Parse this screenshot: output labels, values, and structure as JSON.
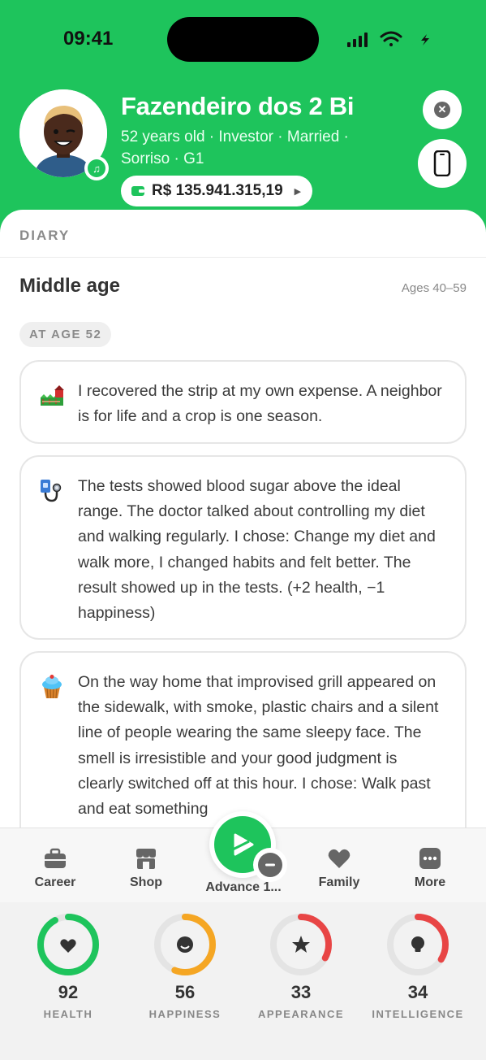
{
  "status_bar": {
    "time": "09:41"
  },
  "profile": {
    "name": "Fazendeiro dos 2 Bi",
    "subtitle": "52 years old · Investor · Married · Sorriso · G1",
    "money": "R$ 135.941.315,19"
  },
  "diary": {
    "label": "DIARY",
    "section_title": "Middle age",
    "section_range": "Ages 40–59",
    "age_chip": "AT AGE 52",
    "entries": [
      {
        "icon": "farm-icon",
        "text": "I recovered the strip at my own expense. A neighbor is for life and a crop is one season."
      },
      {
        "icon": "stethoscope-icon",
        "text": "The tests showed blood sugar above the ideal range. The doctor talked about controlling my diet and walking regularly. I chose: Change my diet and walk more, I changed habits and felt better. The result showed up in the tests. (+2 health, −1 happiness)"
      },
      {
        "icon": "cupcake-icon",
        "text": "On the way home that improvised grill appeared on the sidewalk, with smoke, plastic chairs and a silent line of people wearing the same sleepy face. The smell is irresistible and your good judgment is clearly switched off at this hour. I chose: Walk past and eat something"
      }
    ]
  },
  "nav": {
    "career": "Career",
    "shop": "Shop",
    "advance": "Advance 1...",
    "family": "Family",
    "more": "More"
  },
  "stats": [
    {
      "name": "HEALTH",
      "value": "92",
      "level": 0.92,
      "color": "#1ec45c",
      "icon": "heart-icon"
    },
    {
      "name": "HAPPINESS",
      "value": "56",
      "level": 0.56,
      "color": "#f5a623",
      "icon": "smile-icon"
    },
    {
      "name": "APPEARANCE",
      "value": "33",
      "level": 0.33,
      "color": "#e84545",
      "icon": "star-icon"
    },
    {
      "name": "INTELLIGENCE",
      "value": "34",
      "level": 0.34,
      "color": "#e84545",
      "icon": "bulb-icon"
    }
  ],
  "colors": {
    "brand": "#1ec45c",
    "ring_track": "#e4e4e4"
  }
}
